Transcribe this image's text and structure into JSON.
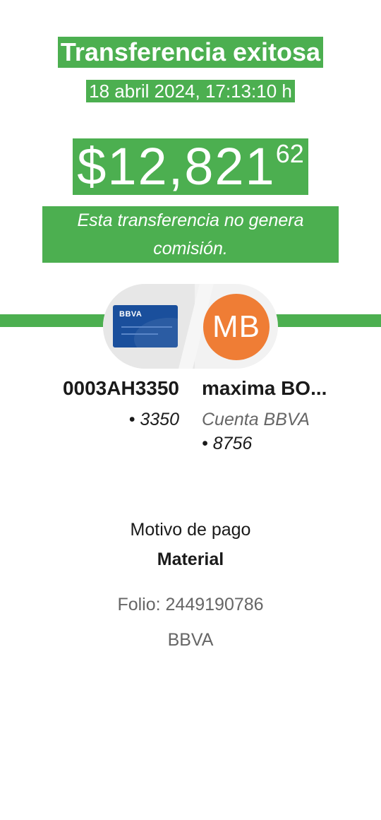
{
  "colors": {
    "accent": "#4caf50",
    "avatar": "#ef7d35",
    "card": "#1a4f9c",
    "text": "#1a1a1a",
    "muted": "#666666"
  },
  "receipt": {
    "title": "Transferencia exitosa",
    "datetime": "18 abril 2024, 17:13:10 h",
    "amount_main": "$12,821",
    "amount_cents": "62",
    "fee_note": "Esta transferencia no genera comisión."
  },
  "origin": {
    "card_brand": "BBVA",
    "card_icon": "bank-card-icon",
    "name": "0003AH3350",
    "last4": "• 3350"
  },
  "destination": {
    "initials": "MB",
    "name": "maxima BO...",
    "account_type": "Cuenta BBVA",
    "last4": "• 8756"
  },
  "details": {
    "reason_label": "Motivo de pago",
    "reason_value": "Material",
    "folio": "Folio: 2449190786",
    "bank": "BBVA"
  }
}
